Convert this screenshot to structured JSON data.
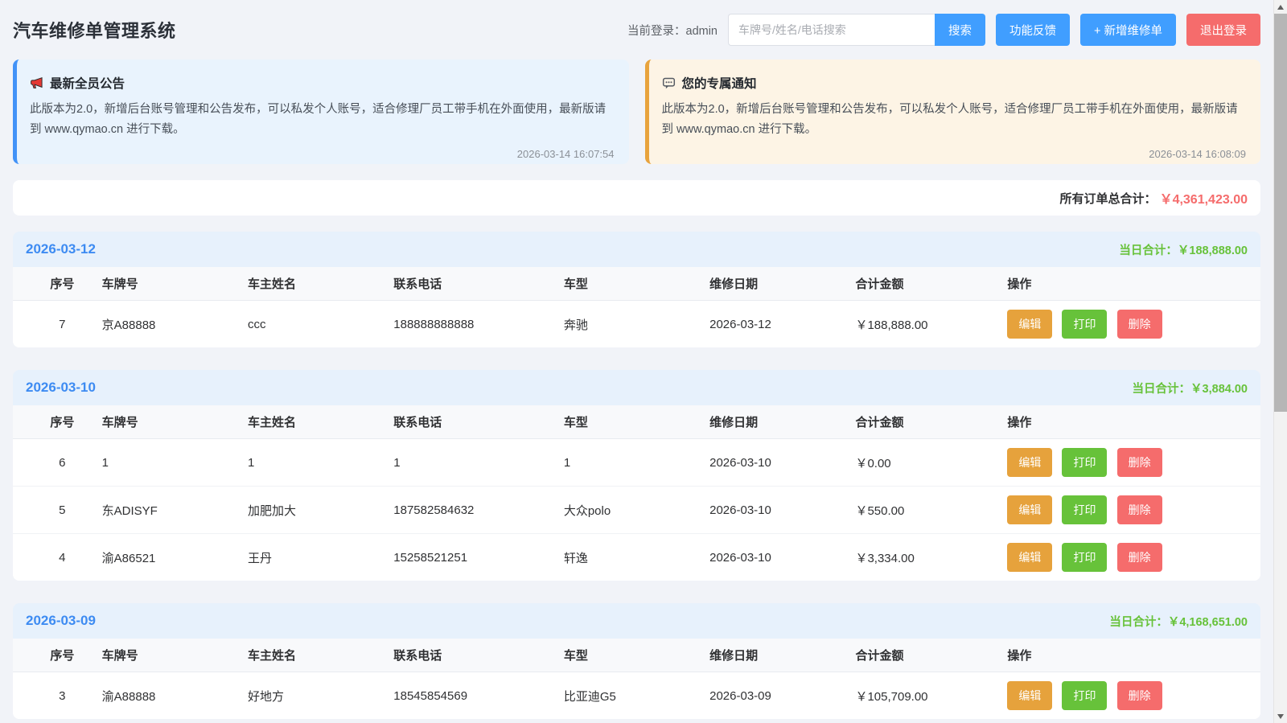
{
  "header": {
    "title": "汽车维修单管理系统",
    "current_login_label": "当前登录：",
    "current_user": "admin",
    "search_placeholder": "车牌号/姓名/电话搜索",
    "search_button": "搜索",
    "feedback_button": "功能反馈",
    "add_button": "+ 新增维修单",
    "logout_button": "退出登录"
  },
  "notices": {
    "announcement": {
      "icon": "megaphone-icon",
      "title": "最新全员公告",
      "body": "此版本为2.0，新增后台账号管理和公告发布，可以私发个人账号，适合修理厂员工带手机在外面使用，最新版请到 www.qymao.cn 进行下载。",
      "timestamp": "2026-03-14 16:07:54"
    },
    "personal": {
      "icon": "speech-bubble-icon",
      "title": "您的专属通知",
      "body": "此版本为2.0，新增后台账号管理和公告发布，可以私发个人账号，适合修理厂员工带手机在外面使用，最新版请到 www.qymao.cn 进行下载。",
      "timestamp": "2026-03-14 16:08:09"
    }
  },
  "summary": {
    "total_label": "所有订单总合计：",
    "total_amount": "￥4,361,423.00"
  },
  "table": {
    "columns": [
      "序号",
      "车牌号",
      "车主姓名",
      "联系电话",
      "车型",
      "维修日期",
      "合计金额",
      "操作"
    ],
    "daily_total_label": "当日合计：",
    "actions": {
      "edit": "编辑",
      "print": "打印",
      "delete": "删除"
    }
  },
  "sections": [
    {
      "date": "2026-03-12",
      "daily_total": "当日合计：￥188,888.00",
      "rows": [
        {
          "seq": "7",
          "plate": "京A88888",
          "owner": "ccc",
          "phone": "188888888888",
          "model": "奔驰",
          "date": "2026-03-12",
          "amount": "￥188,888.00"
        }
      ]
    },
    {
      "date": "2026-03-10",
      "daily_total": "当日合计：￥3,884.00",
      "rows": [
        {
          "seq": "6",
          "plate": "1",
          "owner": "1",
          "phone": "1",
          "model": "1",
          "date": "2026-03-10",
          "amount": "￥0.00"
        },
        {
          "seq": "5",
          "plate": "东ADISYF",
          "owner": "加肥加大",
          "phone": "187582584632",
          "model": "大众polo",
          "date": "2026-03-10",
          "amount": "￥550.00"
        },
        {
          "seq": "4",
          "plate": "渝A86521",
          "owner": "王丹",
          "phone": "15258521251",
          "model": "轩逸",
          "date": "2026-03-10",
          "amount": "￥3,334.00"
        }
      ]
    },
    {
      "date": "2026-03-09",
      "daily_total": "当日合计：￥4,168,651.00",
      "rows": [
        {
          "seq": "3",
          "plate": "渝A88888",
          "owner": "好地方",
          "phone": "18545854569",
          "model": "比亚迪G5",
          "date": "2026-03-09",
          "amount": "￥105,709.00"
        }
      ]
    }
  ],
  "colors": {
    "page_background": "#f1f3f8",
    "primary_blue": "#409eff",
    "danger_red": "#f56c6c",
    "success_green": "#67c23a",
    "warning_orange": "#e6a23c",
    "date_blue": "#3d8bf2",
    "announcement_bg": "#e9f3fd",
    "personal_notice_bg": "#fdf4e5"
  }
}
